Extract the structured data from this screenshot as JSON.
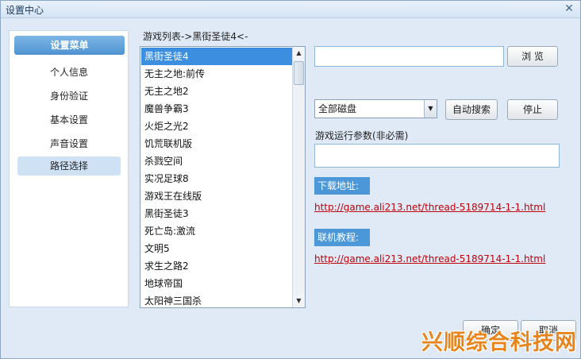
{
  "window": {
    "title": "设置中心"
  },
  "sidebar": {
    "header": "设置菜单",
    "items": [
      {
        "label": "个人信息"
      },
      {
        "label": "身份验证"
      },
      {
        "label": "基本设置"
      },
      {
        "label": "声音设置"
      },
      {
        "label": "路径选择"
      }
    ]
  },
  "game_list": {
    "title": "游戏列表->黑街圣徒4<-",
    "items": [
      "黑街圣徒4",
      "无主之地:前传",
      "无主之地2",
      "魔兽争霸3",
      "火炬之光2",
      "饥荒联机版",
      "杀戮空间",
      "实况足球8",
      "游戏王在线版",
      "黑街圣徒3",
      "死亡岛:激流",
      "文明5",
      "求生之路2",
      "地球帝国",
      "太阳神三国杀"
    ]
  },
  "path": {
    "value": "",
    "browse_label": "浏 览"
  },
  "search": {
    "disk": "全部磁盘",
    "auto_search_label": "自动搜索",
    "stop_label": "停止"
  },
  "params": {
    "label": "游戏运行参数(非必需)",
    "value": ""
  },
  "download": {
    "label": "下载地址:",
    "url": "http://game.ali213.net/thread-5189714-1-1.html"
  },
  "tutorial": {
    "label": "联机教程:",
    "url": "http://game.ali213.net/thread-5189714-1-1.html"
  },
  "footer": {
    "ok_label": "确定",
    "cancel_label": "取消"
  },
  "watermark": "兴顺综合科技网"
}
